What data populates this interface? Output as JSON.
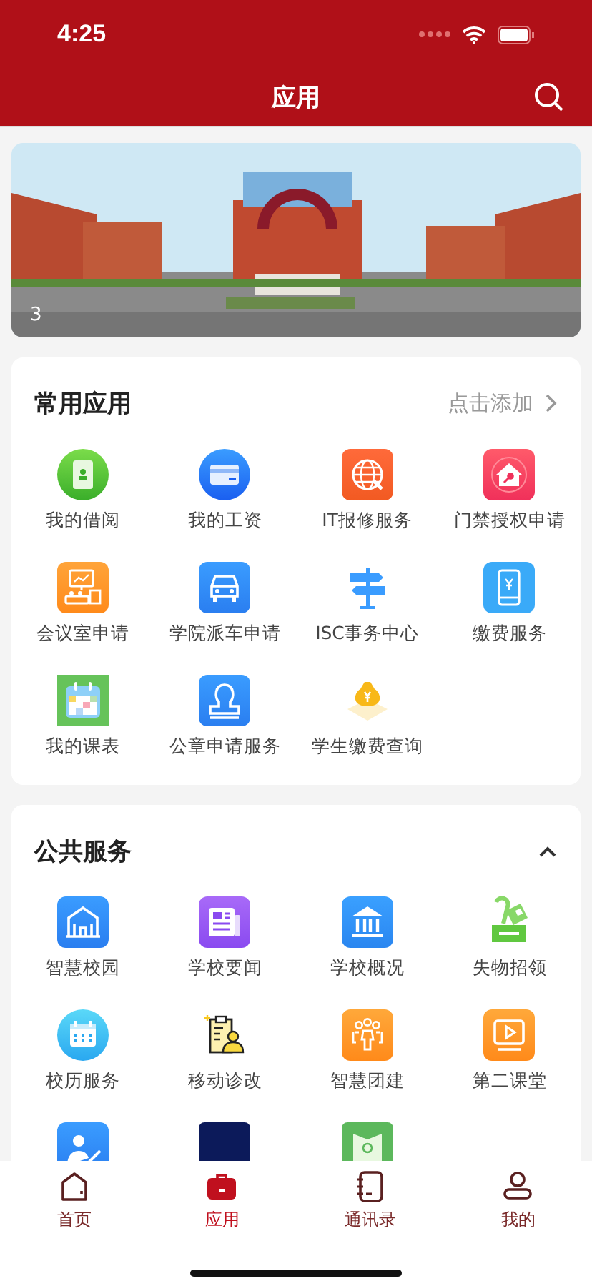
{
  "status_bar": {
    "time": "4:25"
  },
  "header": {
    "title": "应用"
  },
  "banner": {
    "kind": "picture",
    "page": "3"
  },
  "sections": [
    {
      "title": "常用应用",
      "action": "点击添加",
      "apps": [
        {
          "kind": "book",
          "label": "我的借阅"
        },
        {
          "kind": "card",
          "label": "我的工资"
        },
        {
          "kind": "globe",
          "label": "IT报修服务"
        },
        {
          "kind": "housekey",
          "label": "门禁授权申请"
        },
        {
          "kind": "meeting",
          "label": "会议室申请"
        },
        {
          "kind": "car",
          "label": "学院派车申请"
        },
        {
          "kind": "signpost",
          "label": "ISC事务中心"
        },
        {
          "kind": "phone",
          "label": "缴费服务"
        },
        {
          "kind": "schedule",
          "label": "我的课表"
        },
        {
          "kind": "stamp",
          "label": "公章申请服务"
        },
        {
          "kind": "moneybag",
          "label": "学生缴费查询"
        }
      ]
    },
    {
      "title": "公共服务",
      "expanded": true,
      "apps": [
        {
          "kind": "building",
          "label": "智慧校园"
        },
        {
          "kind": "news",
          "label": "学校要闻"
        },
        {
          "kind": "bank",
          "label": "学校概况"
        },
        {
          "kind": "lostfound",
          "label": "失物招领"
        },
        {
          "kind": "calendar",
          "label": "校历服务"
        },
        {
          "kind": "clipboard",
          "label": "移动诊改"
        },
        {
          "kind": "people",
          "label": "智慧团建"
        },
        {
          "kind": "play",
          "label": "第二课堂"
        },
        {
          "kind": "teacher"
        },
        {
          "kind": "navy"
        },
        {
          "kind": "mail"
        }
      ]
    }
  ],
  "tabs": [
    {
      "kind": "home",
      "label": "首页",
      "selected": false
    },
    {
      "kind": "bag",
      "label": "应用",
      "selected": true
    },
    {
      "kind": "contacts",
      "label": "通讯录",
      "selected": false
    },
    {
      "kind": "user",
      "label": "我的",
      "selected": false
    }
  ]
}
